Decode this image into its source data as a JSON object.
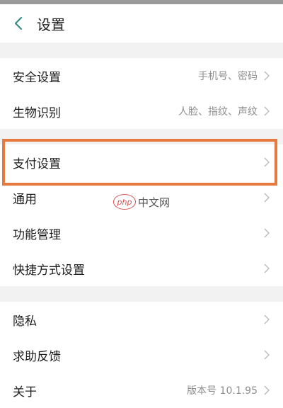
{
  "header": {
    "title": "设置"
  },
  "groups": [
    {
      "items": [
        {
          "label": "安全设置",
          "value": "手机号、密码"
        },
        {
          "label": "生物识别",
          "value": "人脸、指纹、声纹"
        }
      ]
    },
    {
      "items": [
        {
          "label": "支付设置",
          "value": ""
        },
        {
          "label": "通用",
          "value": ""
        },
        {
          "label": "功能管理",
          "value": ""
        },
        {
          "label": "快捷方式设置",
          "value": ""
        }
      ]
    },
    {
      "items": [
        {
          "label": "隐私",
          "value": ""
        },
        {
          "label": "求助反馈",
          "value": ""
        },
        {
          "label": "关于",
          "value": "版本号 10.1.95"
        }
      ]
    }
  ],
  "watermark": {
    "logo": "php",
    "text": "中文网"
  },
  "colors": {
    "accent": "#3a8a86",
    "highlight": "#e6793e"
  }
}
